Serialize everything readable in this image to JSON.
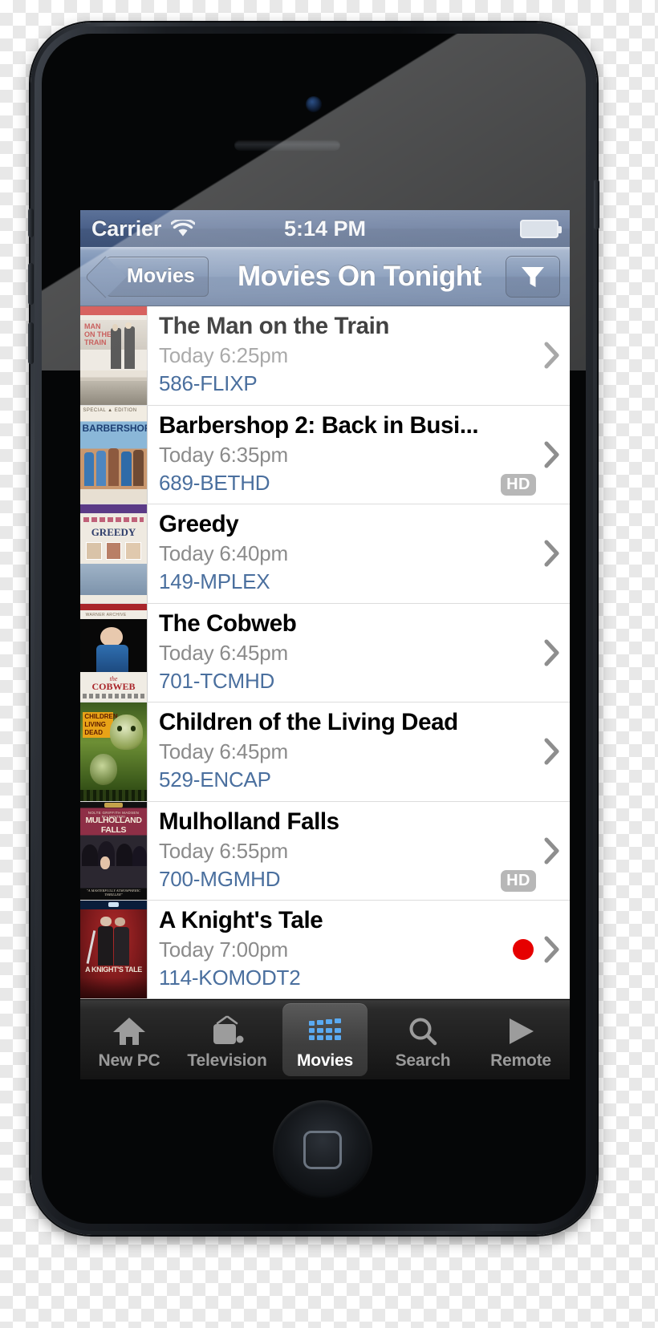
{
  "device": {
    "type": "smartphone-black",
    "home_button": "home-button"
  },
  "status_bar": {
    "carrier": "Carrier",
    "wifi_icon": "wifi-icon",
    "time": "5:14 PM",
    "battery_icon": "battery-icon"
  },
  "nav_bar": {
    "back_label": "Movies",
    "title": "Movies On Tonight",
    "filter_icon": "filter-funnel-icon"
  },
  "list": {
    "rows": [
      {
        "title": "The Man on the Train",
        "time": "Today 6:25pm",
        "channel": "586-FLIXP",
        "hd": "",
        "recording": false,
        "poster_name": "poster-man-on-the-train"
      },
      {
        "title": "Barbershop 2: Back in Busi...",
        "time": "Today 6:35pm",
        "channel": "689-BETHD",
        "hd": "HD",
        "recording": false,
        "poster_name": "poster-barbershop-2"
      },
      {
        "title": "Greedy",
        "time": "Today 6:40pm",
        "channel": "149-MPLEX",
        "hd": "",
        "recording": false,
        "poster_name": "poster-greedy"
      },
      {
        "title": "The Cobweb",
        "time": "Today 6:45pm",
        "channel": "701-TCMHD",
        "hd": "",
        "recording": false,
        "poster_name": "poster-the-cobweb"
      },
      {
        "title": "Children of the Living Dead",
        "time": "Today 6:45pm",
        "channel": "529-ENCAP",
        "hd": "",
        "recording": false,
        "poster_name": "poster-children-living-dead"
      },
      {
        "title": "Mulholland Falls",
        "time": "Today 6:55pm",
        "channel": "700-MGMHD",
        "hd": "HD",
        "recording": false,
        "poster_name": "poster-mulholland-falls"
      },
      {
        "title": "A Knight's Tale",
        "time": "Today 7:00pm",
        "channel": "114-KOMODT2",
        "hd": "",
        "recording": true,
        "poster_name": "poster-a-knights-tale"
      }
    ]
  },
  "tab_bar": {
    "selected_index": 2,
    "tabs": [
      {
        "label": "New PC",
        "icon": "home-icon"
      },
      {
        "label": "Television",
        "icon": "tv-icon"
      },
      {
        "label": "Movies",
        "icon": "film-clapper-icon"
      },
      {
        "label": "Search",
        "icon": "magnifier-icon"
      },
      {
        "label": "Remote",
        "icon": "play-triangle-icon"
      }
    ]
  },
  "colors": {
    "navbar_blue": "#5e789f",
    "statusbar_blue": "#43587f",
    "channel_link": "#4a6f9e",
    "time_gray": "#8b8b8b",
    "hd_badge_gray": "#b7b7b7",
    "record_red": "#e60000",
    "tab_selected_blue": "#5aaaf2",
    "chevron_gray": "#8e8e8e"
  }
}
